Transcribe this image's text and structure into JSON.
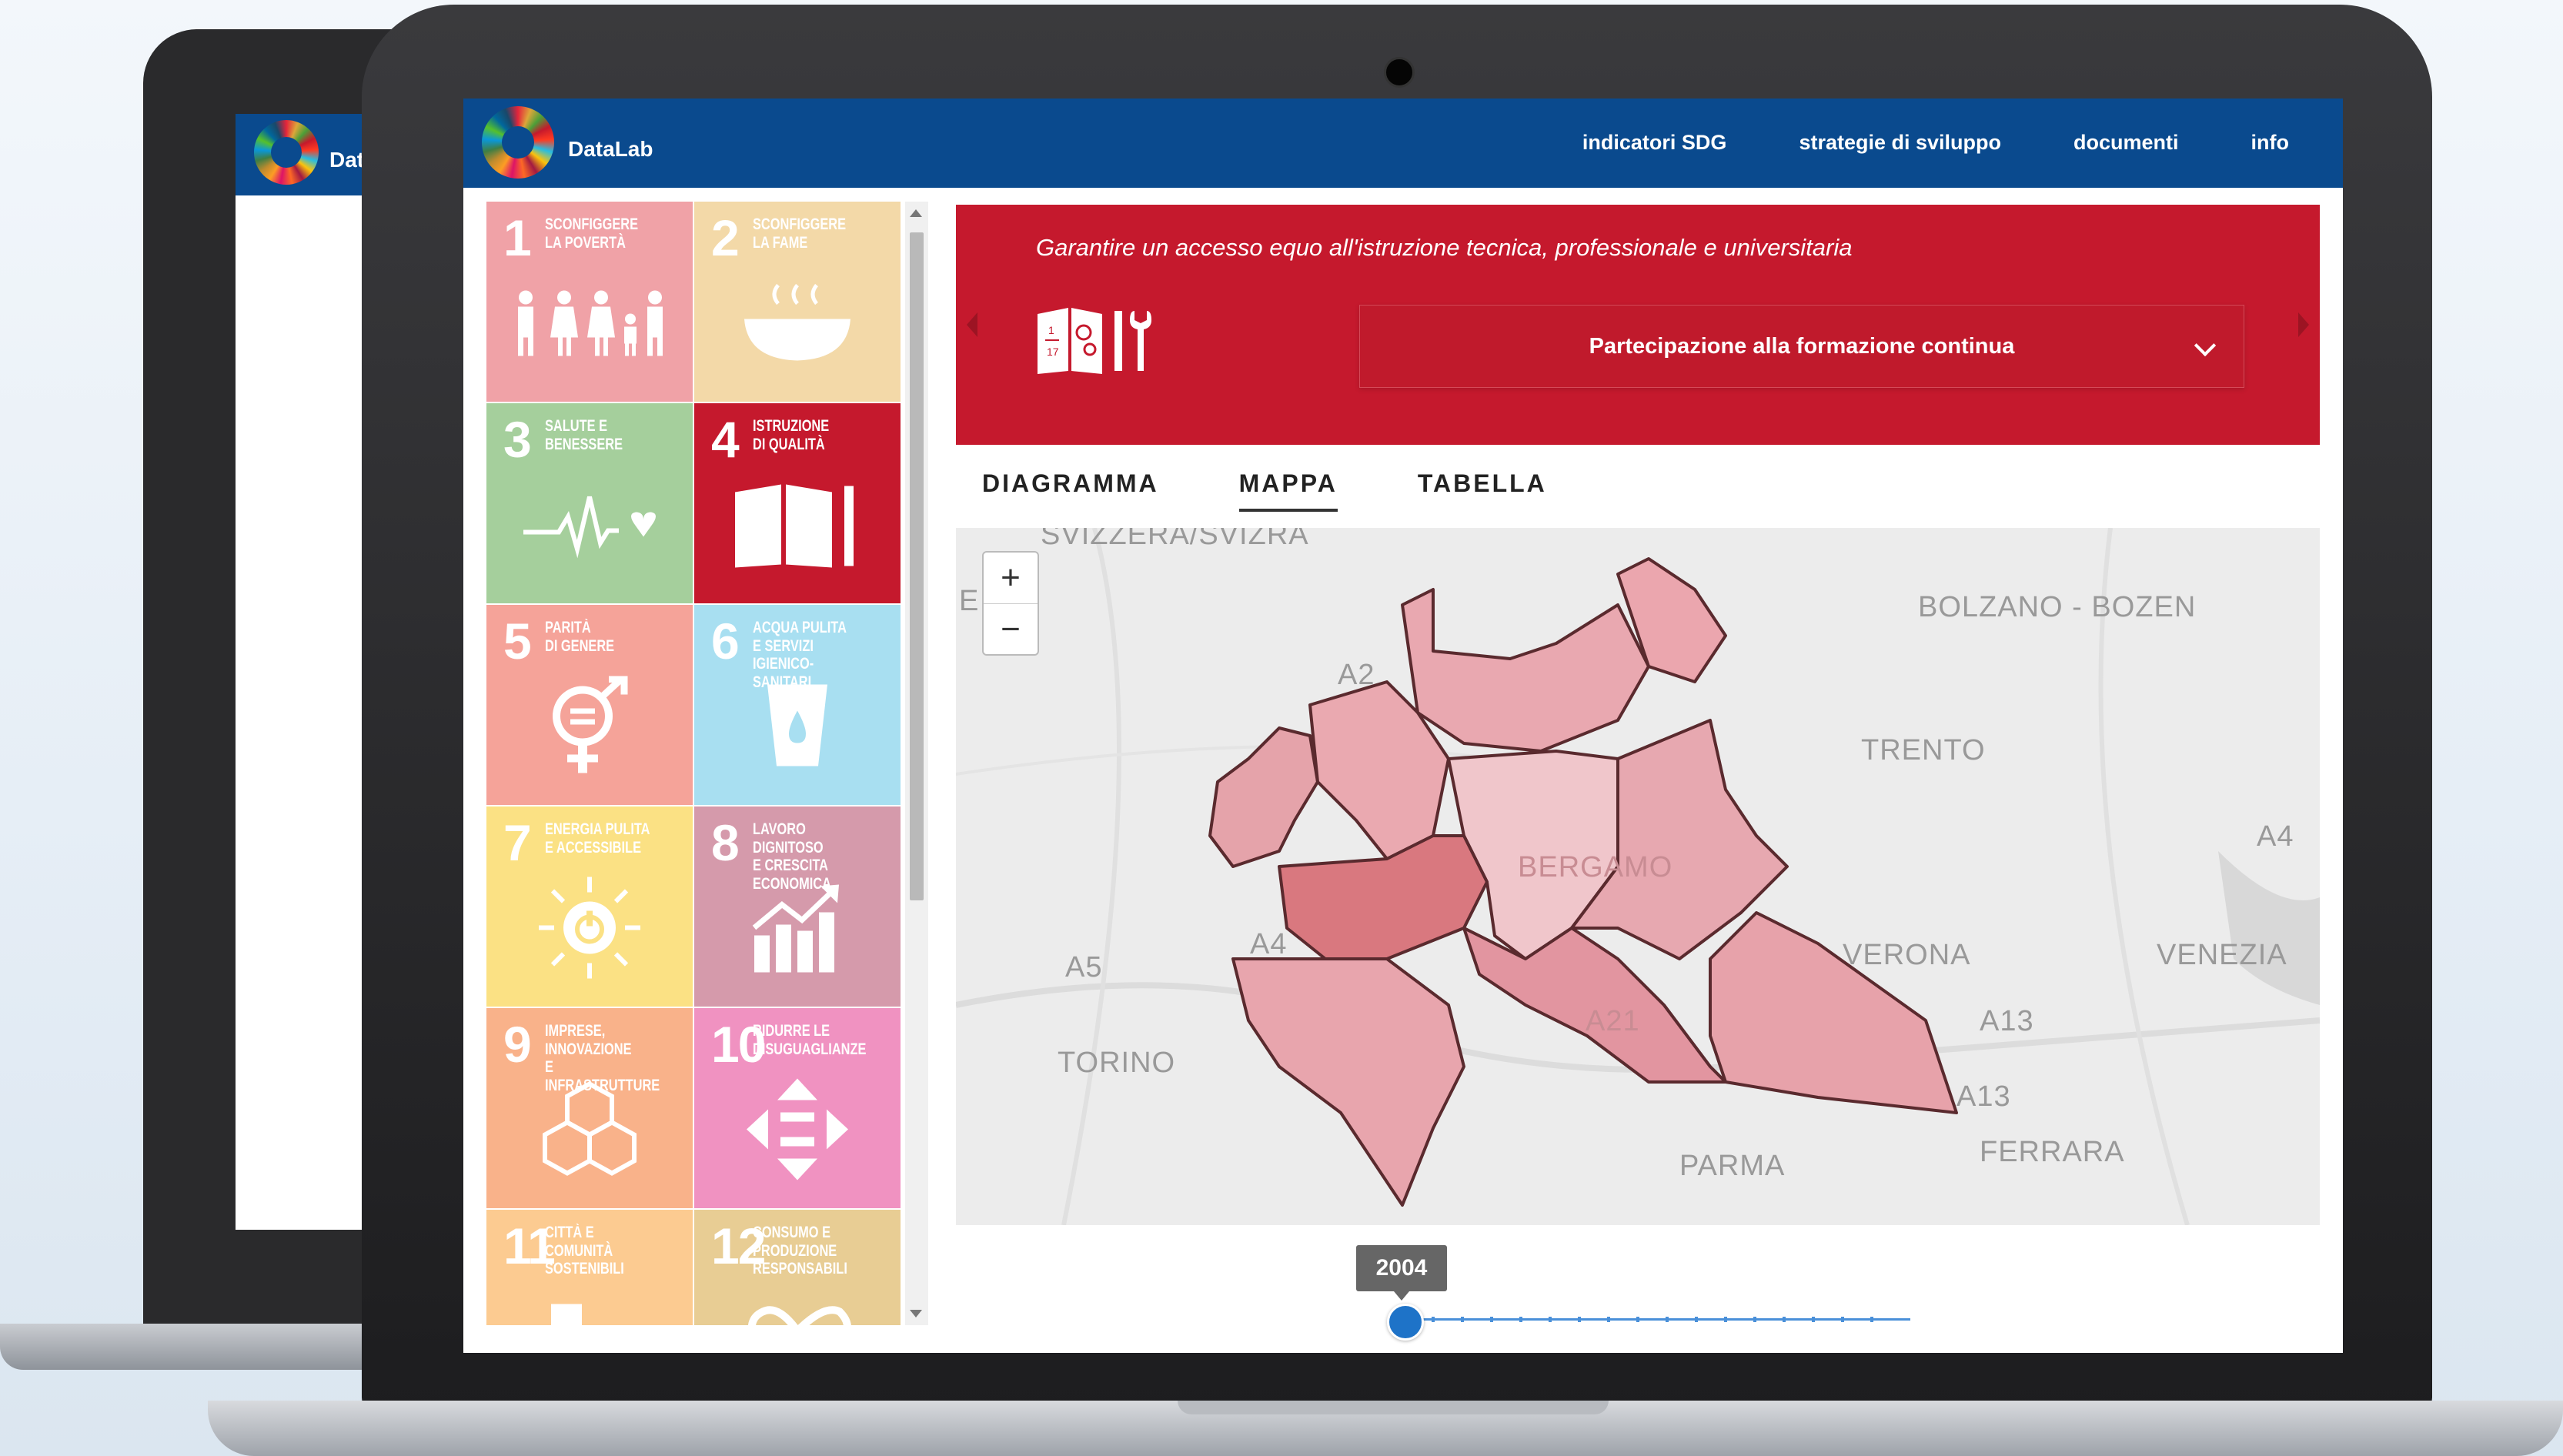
{
  "app": {
    "brand": "DataLab",
    "bg_brand": "Dat",
    "nav": [
      "indicatori SDG",
      "strategie di sviluppo",
      "documenti",
      "info"
    ]
  },
  "sdg_tiles": [
    {
      "num": "1",
      "label": "SCONFIGGERE\nLA POVERTÀ",
      "color": "#f0a2a7",
      "icon": "family-icon"
    },
    {
      "num": "2",
      "label": "SCONFIGGERE\nLA FAME",
      "color": "#f3d9a8",
      "icon": "bowl-icon"
    },
    {
      "num": "3",
      "label": "SALUTE E\nBENESSERE",
      "color": "#a5cf9c",
      "icon": "heartbeat-icon"
    },
    {
      "num": "4",
      "label": "ISTRUZIONE\nDI QUALITÀ",
      "color": "#c5192d",
      "icon": "book-pen-icon"
    },
    {
      "num": "5",
      "label": "PARITÀ\nDI GENERE",
      "color": "#f5a399",
      "icon": "gender-icon"
    },
    {
      "num": "6",
      "label": "ACQUA PULITA\nE SERVIZI\nIGIENICO-SANITARI",
      "color": "#a8dff1",
      "icon": "water-glass-icon"
    },
    {
      "num": "7",
      "label": "ENERGIA PULITA\nE ACCESSIBILE",
      "color": "#fbe184",
      "icon": "sun-power-icon"
    },
    {
      "num": "8",
      "label": "LAVORO DIGNITOSO\nE CRESCITA\nECONOMICA",
      "color": "#d59aab",
      "icon": "growth-chart-icon"
    },
    {
      "num": "9",
      "label": "IMPRESE,\nINNOVAZIONE\nE INFRASTRUTTURE",
      "color": "#f9b28a",
      "icon": "cubes-icon"
    },
    {
      "num": "10",
      "label": "RIDURRE LE\nDISUGUAGLIANZE",
      "color": "#f092c1",
      "icon": "equality-icon"
    },
    {
      "num": "11",
      "label": "CITTÀ E COMUNITÀ\nSOSTENIBILI",
      "color": "#fccb91",
      "icon": "city-icon"
    },
    {
      "num": "12",
      "label": "CONSUMO E\nPRODUZIONE\nRESPONSABILI",
      "color": "#e8cd94",
      "icon": "infinity-icon"
    }
  ],
  "banner": {
    "target": "Garantire un accesso equo all'istruzione tecnica, professionale e universitaria",
    "indicator": "Partecipazione alla formazione continua",
    "color": "#c5192d"
  },
  "tabs": [
    "DIAGRAMMA",
    "MAPPA",
    "TABELLA"
  ],
  "active_tab": "MAPPA",
  "map": {
    "zoom_in": "+",
    "zoom_out": "−",
    "labels": [
      "SVIZZERA/SVIZRA",
      "BOLZANO - BOZEN",
      "TRENTO",
      "A2",
      "A4",
      "A4",
      "A5",
      "VERONA",
      "VENEZIA",
      "A13",
      "A13",
      "TORINO",
      "PARMA",
      "FERRARA",
      "E",
      "BERGAMO",
      "A21"
    ]
  },
  "timeline": {
    "year": "2004",
    "position": 0
  }
}
